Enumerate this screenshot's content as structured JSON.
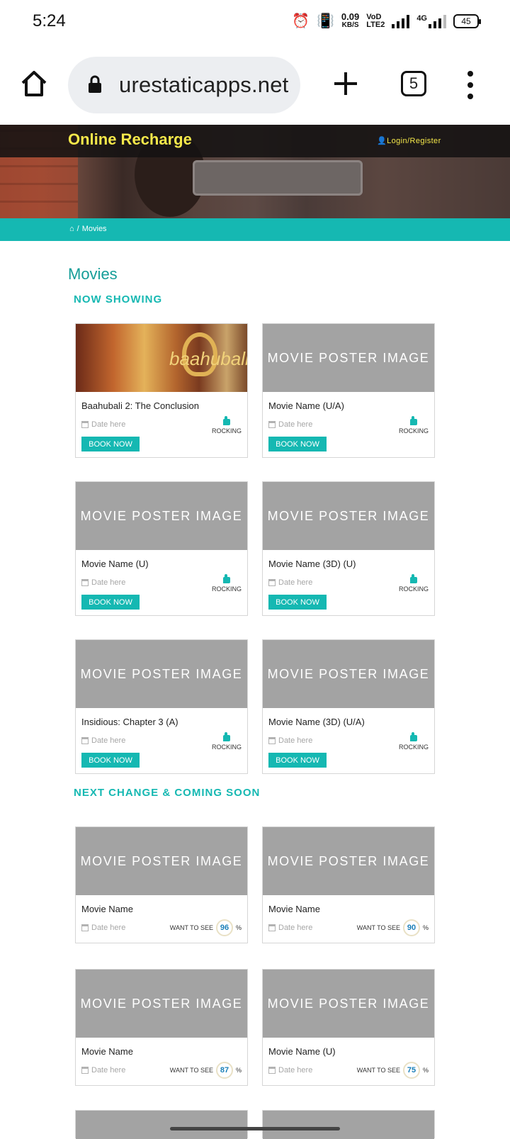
{
  "status_bar": {
    "time": "5:24",
    "net_speed_value": "0.09",
    "net_speed_unit": "KB/S",
    "volte_top": "VoD",
    "volte_bottom": "LTE2",
    "network_type": "4G",
    "battery": "45"
  },
  "browser": {
    "url": "urestaticapps.net",
    "tab_count": "5"
  },
  "header": {
    "brand": "Online Recharge",
    "login": "Login/Register"
  },
  "breadcrumb": {
    "separator": "/",
    "current": "Movies"
  },
  "page": {
    "title": "Movies"
  },
  "now_showing": {
    "heading": "NOW SHOWING",
    "movies": [
      {
        "name": "Baahubali 2: The Conclusion",
        "date": "Date here",
        "book": "BOOK NOW",
        "rating": "ROCKING",
        "poster": "baahubali",
        "poster_title": "baahubali"
      },
      {
        "name": "Movie Name (U/A)",
        "date": "Date here",
        "book": "BOOK NOW",
        "rating": "ROCKING",
        "poster_text": "MOVIE POSTER IMAGE"
      },
      {
        "name": "Movie Name (U)",
        "date": "Date here",
        "book": "BOOK NOW",
        "rating": "ROCKING",
        "poster_text": "MOVIE POSTER IMAGE"
      },
      {
        "name": "Movie Name (3D) (U)",
        "date": "Date here",
        "book": "BOOK NOW",
        "rating": "ROCKING",
        "poster_text": "MOVIE POSTER IMAGE"
      },
      {
        "name": "Insidious: Chapter 3 (A)",
        "date": "Date here",
        "book": "BOOK NOW",
        "rating": "ROCKING",
        "poster_text": "MOVIE POSTER IMAGE"
      },
      {
        "name": "Movie Name (3D) (U/A)",
        "date": "Date here",
        "book": "BOOK NOW",
        "rating": "ROCKING",
        "poster_text": "MOVIE POSTER IMAGE"
      }
    ]
  },
  "coming_soon": {
    "heading": "NEXT CHANGE & COMING SOON",
    "movies": [
      {
        "name": "Movie Name",
        "date": "Date here",
        "want_label": "WANT TO SEE",
        "percent": "96",
        "percent_sign": "%",
        "poster_text": "MOVIE POSTER IMAGE"
      },
      {
        "name": "Movie Name",
        "date": "Date here",
        "want_label": "WANT TO SEE",
        "percent": "90",
        "percent_sign": "%",
        "poster_text": "MOVIE POSTER IMAGE"
      },
      {
        "name": "Movie Name",
        "date": "Date here",
        "want_label": "WANT TO SEE",
        "percent": "87",
        "percent_sign": "%",
        "poster_text": "MOVIE POSTER IMAGE"
      },
      {
        "name": "Movie Name (U)",
        "date": "Date here",
        "want_label": "WANT TO SEE",
        "percent": "75",
        "percent_sign": "%",
        "poster_text": "MOVIE POSTER IMAGE"
      }
    ]
  },
  "colors": {
    "accent": "#15b8b2",
    "brand_yellow": "#f5e84a",
    "poster_gray": "#a3a3a3",
    "percent_blue": "#1a7fb8"
  }
}
